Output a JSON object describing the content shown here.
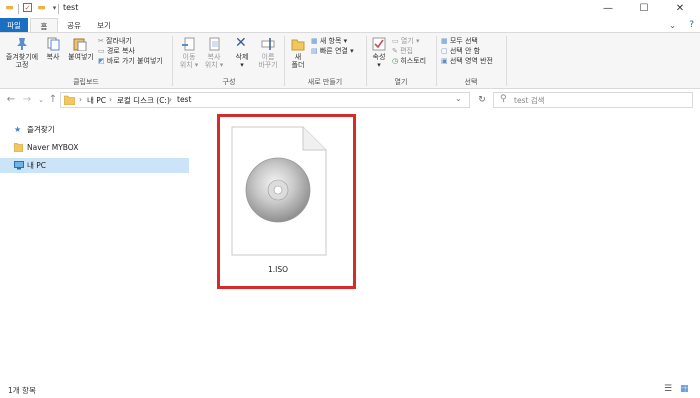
{
  "window": {
    "title": "test",
    "controls": {
      "minimize": "—",
      "maximize": "☐",
      "close": "✕"
    }
  },
  "ribbon": {
    "tabs": [
      "파일",
      "홈",
      "공유",
      "보기"
    ],
    "clipboard": {
      "pin_label_1": "즐겨찾기에",
      "pin_label_2": "고정",
      "copy": "복사",
      "paste": "붙여넣기",
      "cut": "잘라내기",
      "copy_path": "경로 복사",
      "paste_shortcut": "바로 가기 붙여넣기",
      "group": "클립보드"
    },
    "organize": {
      "move_to_1": "이동",
      "move_to_2": "위치 ▾",
      "copy_to_1": "복사",
      "copy_to_2": "위치 ▾",
      "delete_1": "삭제",
      "delete_2": "▾",
      "rename_1": "이름",
      "rename_2": "바꾸기",
      "group": "구성"
    },
    "new": {
      "new_folder_1": "새",
      "new_folder_2": "폴더",
      "new_item": "새 항목 ▾",
      "easy_access": "빠른 연결 ▾",
      "group": "새로 만들기"
    },
    "open": {
      "properties_1": "속성",
      "properties_2": "▾",
      "open": "열기 ▾",
      "edit": "편집",
      "history": "히스토리",
      "group": "열기"
    },
    "select": {
      "select_all": "모두 선택",
      "select_none": "선택 안 함",
      "invert": "선택 영역 반전",
      "group": "선택"
    }
  },
  "address": {
    "crumbs": [
      "내 PC",
      "로컬 디스크 (C:)",
      "test"
    ],
    "separator": "›",
    "search_placeholder": "test 검색"
  },
  "nav": {
    "items": [
      "즐겨찾기",
      "Naver MYBOX",
      "내 PC"
    ]
  },
  "files": [
    {
      "name": "1.ISO"
    }
  ],
  "status": {
    "count": "1개 항목"
  },
  "colors": {
    "accent": "#1b6fc0",
    "highlight_box": "#d42b2b",
    "selected_nav": "#cce4f7"
  }
}
